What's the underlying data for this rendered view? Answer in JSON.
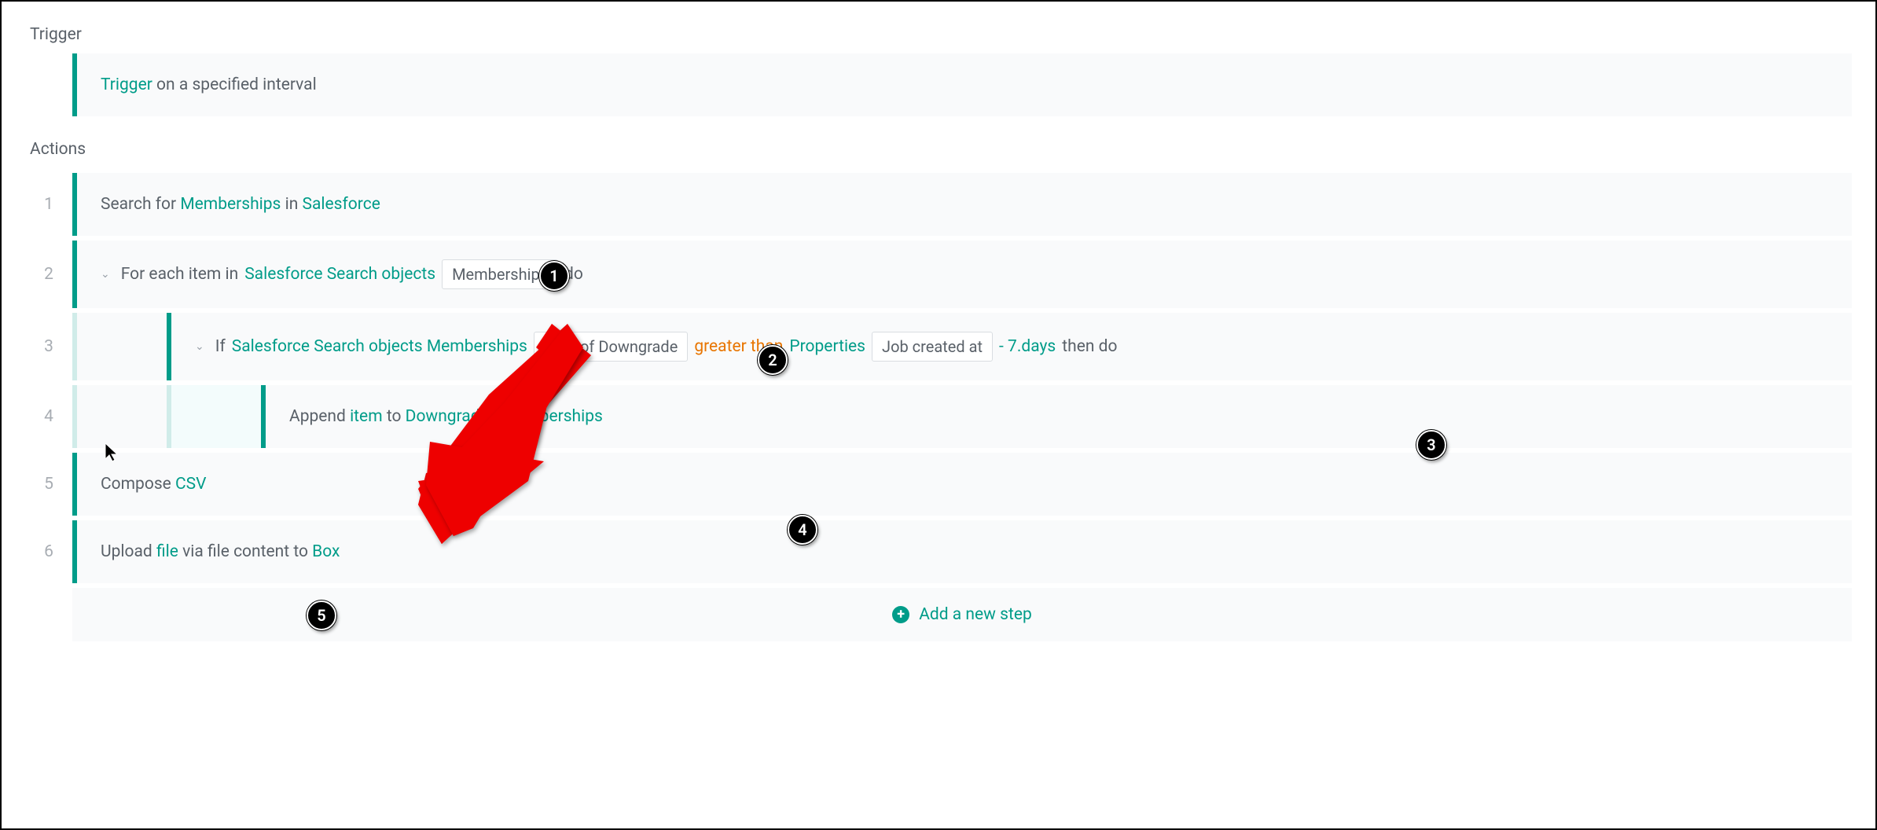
{
  "sections": {
    "trigger_label": "Trigger",
    "actions_label": "Actions"
  },
  "trigger": {
    "prefix_accent": "Trigger",
    "suffix": " on a specified interval"
  },
  "steps": {
    "s1": {
      "num": "1",
      "t1": "Search for ",
      "a1": "Memberships",
      "t2": " in ",
      "a2": "Salesforce"
    },
    "s2": {
      "num": "2",
      "t1": "For each item in ",
      "a1": "Salesforce Search objects",
      "pill1": "Memberships",
      "t2": " do"
    },
    "s3": {
      "num": "3",
      "t1": "If ",
      "a1": "Salesforce Search objects Memberships",
      "pill1": "Date of Downgrade",
      "o1": "greater than",
      "a2": "Properties",
      "pill2": "Job created at",
      "a3": "- 7.days",
      "t2": " then do"
    },
    "s4": {
      "num": "4",
      "t1": "Append ",
      "a1": "item",
      "t2": " to ",
      "a2": "Downgraded Memberships"
    },
    "s5": {
      "num": "5",
      "t1": "Compose ",
      "a1": "CSV"
    },
    "s6": {
      "num": "6",
      "t1": "Upload ",
      "a1": "file",
      "t2": " via file content to ",
      "a2": "Box"
    }
  },
  "add_step": {
    "label": "Add a new step"
  },
  "annotations": {
    "a1": "1",
    "a2": "2",
    "a3": "3",
    "a4": "4",
    "a5": "5"
  }
}
